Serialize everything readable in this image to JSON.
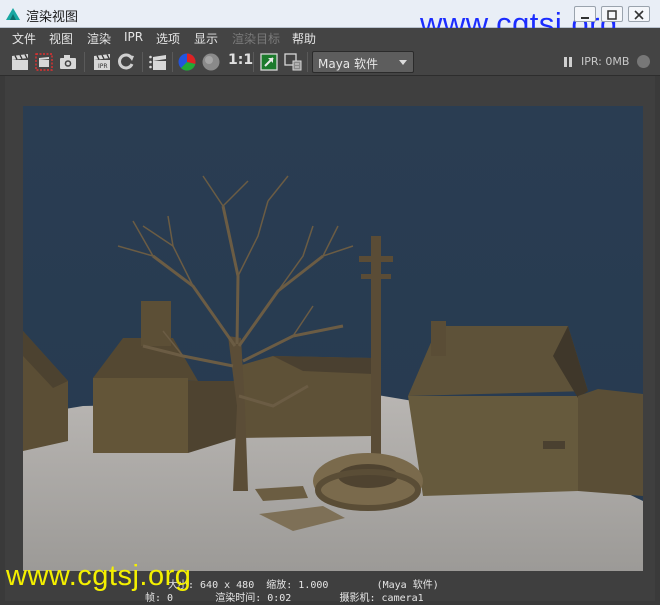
{
  "window": {
    "title": "渲染视图"
  },
  "watermark": {
    "text": "www.cgtsj.org"
  },
  "menu": [
    {
      "label": "文件",
      "enabled": true
    },
    {
      "label": "视图",
      "enabled": true
    },
    {
      "label": "渲染",
      "enabled": true
    },
    {
      "label": "IPR",
      "enabled": true
    },
    {
      "label": "选项",
      "enabled": true
    },
    {
      "label": "显示",
      "enabled": true
    },
    {
      "label": "渲染目标",
      "enabled": false
    },
    {
      "label": "帮助",
      "enabled": true
    }
  ],
  "toolbar": {
    "ratio_label": "1:1",
    "renderer": "Maya 软件",
    "ipr_status": "IPR: 0MB",
    "icons": [
      "render-clapper-icon",
      "render-region-icon",
      "snapshot-camera-icon",
      "ipr-clapper-icon",
      "refresh-ipr-icon",
      "render-sequence-icon",
      "rgb-channels-icon",
      "alpha-channel-icon",
      "keep-image-icon",
      "remove-image-icon"
    ]
  },
  "status": {
    "line1": "大小: 640 x 480  缩放: 1.000        (Maya 软件)",
    "line2": "帧: 0       渲染时间: 0:02        摄影机: camera1"
  }
}
